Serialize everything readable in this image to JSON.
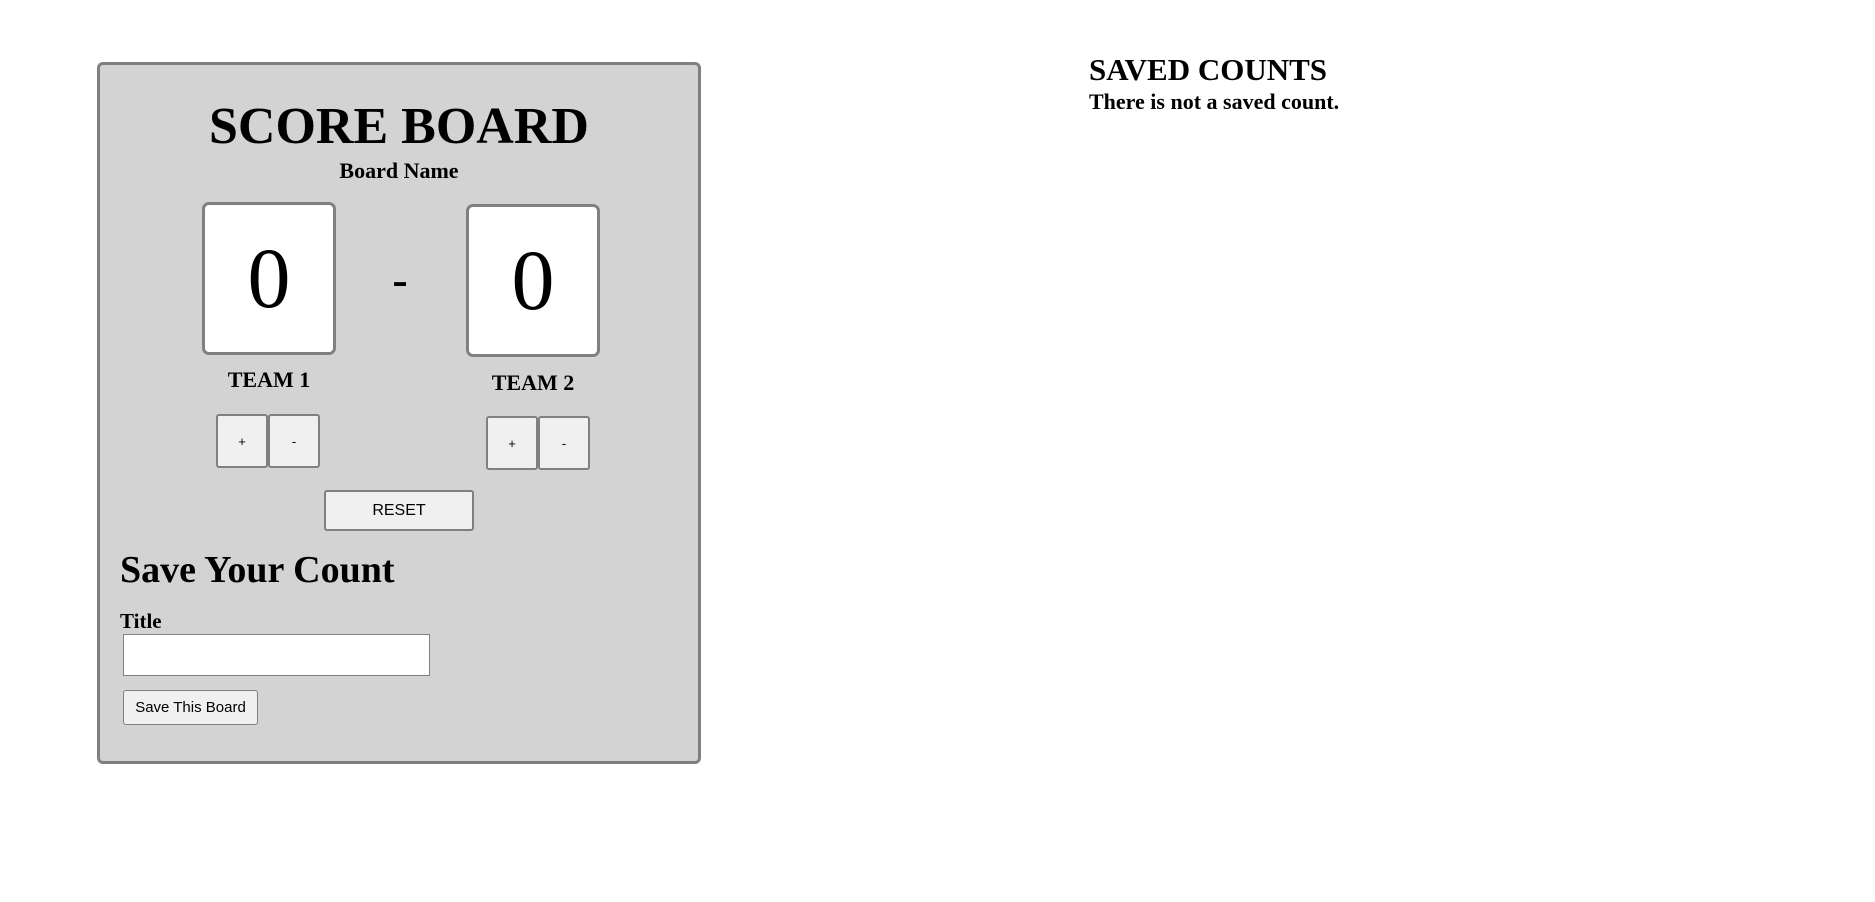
{
  "board": {
    "title": "SCORE BOARD",
    "name": "Board Name",
    "separator": "-",
    "teams": [
      {
        "label": "TEAM 1",
        "score": "0",
        "plus": "+",
        "minus": "-"
      },
      {
        "label": "TEAM 2",
        "score": "0",
        "plus": "+",
        "minus": "-"
      }
    ],
    "reset_label": "RESET"
  },
  "save_form": {
    "heading": "Save Your Count",
    "title_label": "Title",
    "title_value": "",
    "save_label": "Save This Board"
  },
  "saved": {
    "heading": "SAVED COUNTS",
    "empty_message": "There is not a saved count."
  }
}
